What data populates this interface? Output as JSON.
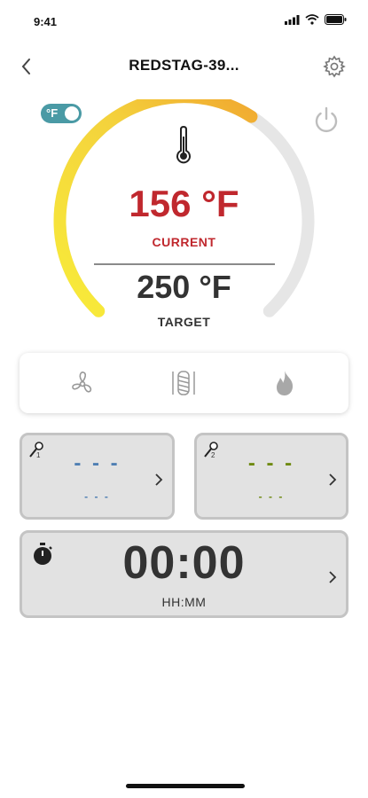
{
  "status_bar": {
    "time": "9:41"
  },
  "header": {
    "title": "REDSTAG-39..."
  },
  "unit_toggle": {
    "label": "°F"
  },
  "gauge": {
    "current_temp": "156 °F",
    "current_label": "CURRENT",
    "target_temp": "250 °F",
    "target_label": "TARGET",
    "progress_fraction": 0.62
  },
  "modes": [
    "fan-icon",
    "auger-icon",
    "flame-icon"
  ],
  "probe1": {
    "number": "1",
    "value": "- - -",
    "sub": "- - -",
    "color": "#4f7fb3"
  },
  "probe2": {
    "number": "2",
    "value": "- - -",
    "sub": "- - -",
    "color": "#6f8a12"
  },
  "timer": {
    "value": "00:00",
    "label": "HH:MM"
  },
  "colors": {
    "accent_teal": "#4a9aa5",
    "current_red": "#c0282e"
  }
}
